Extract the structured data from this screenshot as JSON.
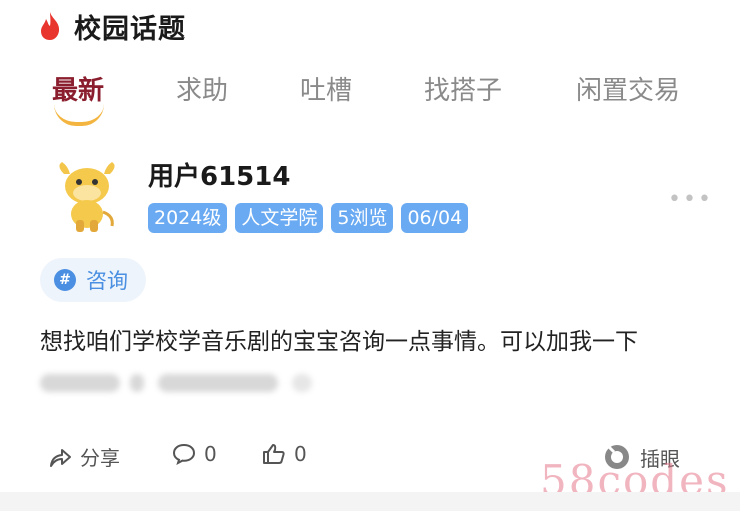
{
  "header": {
    "title": "校园话题",
    "icon": "flame-icon"
  },
  "tabs": [
    {
      "label": "最新",
      "active": true
    },
    {
      "label": "求助",
      "active": false
    },
    {
      "label": "吐槽",
      "active": false
    },
    {
      "label": "找搭子",
      "active": false
    },
    {
      "label": "闲置交易",
      "active": false
    }
  ],
  "post": {
    "username": "用户61514",
    "tags": [
      "2024级",
      "人文学院",
      "5浏览",
      "06/04"
    ],
    "topic": {
      "icon_text": "#",
      "label": "咨询"
    },
    "content": "想找咱们学校学音乐剧的宝宝咨询一点事情。可以加我一下"
  },
  "actions": {
    "share_label": "分享",
    "comment_count": "0",
    "like_count": "0",
    "insert_label": "插眼"
  },
  "watermark": "58codes",
  "colors": {
    "active_tab": "#8b1e2e",
    "tag_bg": "#6aaaf2",
    "topic_blue": "#4a8fe2",
    "indicator": "#f3b53f"
  }
}
